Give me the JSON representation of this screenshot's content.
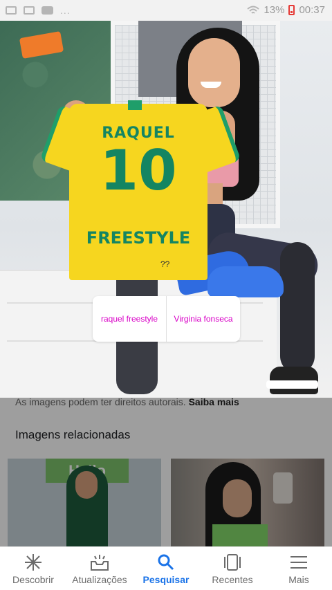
{
  "status_bar": {
    "battery": "13%",
    "time": "00:37",
    "dots": "..."
  },
  "image": {
    "jersey_name": "RAQUEL",
    "jersey_number": "10",
    "jersey_subtitle": "FREESTYLE",
    "overlay_text": "??"
  },
  "suggestion_chips": [
    {
      "label": "raquel freestyle"
    },
    {
      "label": "Virginia fonseca"
    }
  ],
  "copyright": {
    "text": "As imagens podem ter direitos autorais.",
    "link": "Saiba mais"
  },
  "related": {
    "title": "Imagens relacionadas",
    "thumb1_sign": "Hello"
  },
  "bottom_nav": {
    "items": [
      {
        "label": "Descobrir",
        "icon": "asterisk-icon"
      },
      {
        "label": "Atualizações",
        "icon": "inbox-bell-icon"
      },
      {
        "label": "Pesquisar",
        "icon": "search-icon",
        "active": true
      },
      {
        "label": "Recentes",
        "icon": "recent-cards-icon"
      },
      {
        "label": "Mais",
        "icon": "menu-icon"
      }
    ],
    "active_color": "#1a73e8"
  },
  "colors": {
    "chip_text": "#d900c7",
    "jersey_yellow": "#f6d61f",
    "jersey_green": "#148562"
  }
}
